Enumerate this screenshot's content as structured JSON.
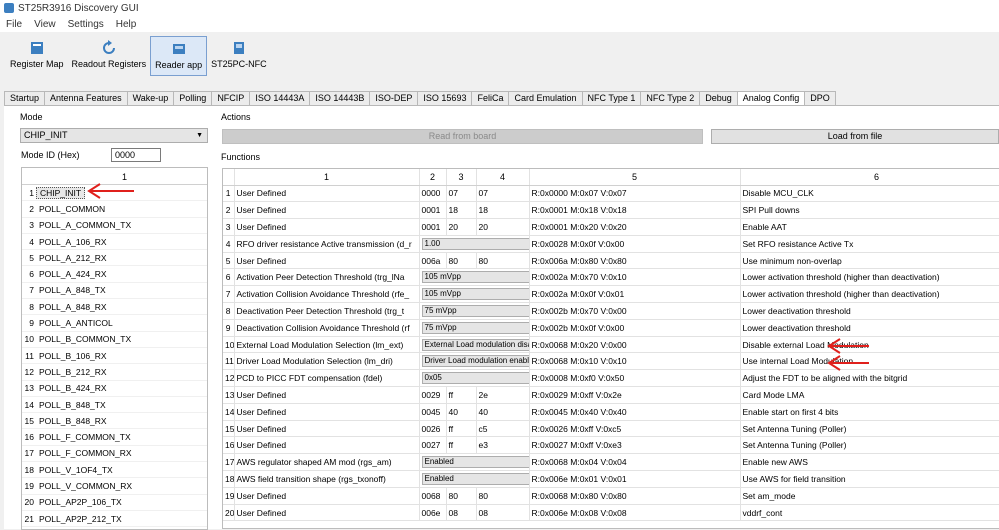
{
  "window": {
    "title": "ST25R3916 Discovery GUI"
  },
  "menu": [
    "File",
    "View",
    "Settings",
    "Help"
  ],
  "toolbar": [
    {
      "label": "Register Map",
      "icon": "register-map-icon",
      "active": false
    },
    {
      "label": "Readout Registers",
      "icon": "refresh-icon",
      "active": false
    },
    {
      "label": "Reader app",
      "icon": "reader-app-icon",
      "active": true
    },
    {
      "label": "ST25PC-NFC",
      "icon": "nfc-device-icon",
      "active": false
    }
  ],
  "tabs": [
    "Startup",
    "Antenna Features",
    "Wake-up",
    "Polling",
    "NFCIP",
    "ISO 14443A",
    "ISO 14443B",
    "ISO-DEP",
    "ISO 15693",
    "FeliCa",
    "Card Emulation",
    "NFC Type 1",
    "NFC Type 2",
    "Debug",
    "Analog Config",
    "DPO"
  ],
  "active_tab": "Analog Config",
  "mode": {
    "group_label": "Mode",
    "selected": "CHIP_INIT",
    "mode_id_label": "Mode ID (Hex)",
    "mode_id_value": "0000",
    "list_header": "1",
    "items": [
      "CHIP_INIT",
      "POLL_COMMON",
      "POLL_A_COMMON_TX",
      "POLL_A_106_RX",
      "POLL_A_212_RX",
      "POLL_A_424_RX",
      "POLL_A_848_TX",
      "POLL_A_848_RX",
      "POLL_A_ANTICOL",
      "POLL_B_COMMON_TX",
      "POLL_B_106_RX",
      "POLL_B_212_RX",
      "POLL_B_424_RX",
      "POLL_B_848_TX",
      "POLL_B_848_RX",
      "POLL_F_COMMON_TX",
      "POLL_F_COMMON_RX",
      "POLL_V_1OF4_TX",
      "POLL_V_COMMON_RX",
      "POLL_AP2P_106_TX",
      "POLL_AP2P_212_TX"
    ]
  },
  "actions": {
    "group_label": "Actions",
    "read_label": "Read from board",
    "load_label": "Load from file"
  },
  "functions": {
    "group_label": "Functions",
    "columns": [
      "1",
      "2",
      "3",
      "4",
      "5",
      "6"
    ],
    "rows": [
      {
        "name": "User Defined",
        "c2": "0000",
        "c3": "07",
        "c4": "07",
        "reg": "R:0x0000 M:0x07 V:0x07",
        "desc": "Disable MCU_CLK"
      },
      {
        "name": "User Defined",
        "c2": "0001",
        "c3": "18",
        "c4": "18",
        "reg": "R:0x0001 M:0x18 V:0x18",
        "desc": "SPI Pull downs"
      },
      {
        "name": "User Defined",
        "c2": "0001",
        "c3": "20",
        "c4": "20",
        "reg": "R:0x0001 M:0x20 V:0x20",
        "desc": "Enable AAT"
      },
      {
        "name": "RFO driver resistance Active transmission (d_r",
        "combo": "1.00",
        "reg": "R:0x0028 M:0x0f V:0x00",
        "desc": "Set RFO resistance Active Tx"
      },
      {
        "name": "User Defined",
        "c2": "006a",
        "c3": "80",
        "c4": "80",
        "reg": "R:0x006a M:0x80 V:0x80",
        "desc": "Use minimum non-overlap"
      },
      {
        "name": "Activation Peer Detection Threshold (trg_lNa",
        "combo": "105 mVpp",
        "reg": "R:0x002a M:0x70 V:0x10",
        "desc": "Lower activation threshold (higher than deactivation)"
      },
      {
        "name": "Activation Collision Avoidance Threshold (rfe_",
        "combo": "105 mVpp",
        "reg": "R:0x002a M:0x0f V:0x01",
        "desc": "Lower activation threshold (higher than deactivation)"
      },
      {
        "name": "Deactivation Peer Detection Threshold (trg_t",
        "combo": "75 mVpp",
        "reg": "R:0x002b M:0x70 V:0x00",
        "desc": "Lower deactivation threshold"
      },
      {
        "name": "Deactivation Collision Avoidance Threshold (rf",
        "combo": "75 mVpp",
        "reg": "R:0x002b M:0x0f V:0x00",
        "desc": "Lower deactivation threshold"
      },
      {
        "name": "External Load Modulation Selection (lm_ext)",
        "combo": "External Load modulation disablec",
        "reg": "R:0x0068 M:0x20 V:0x00",
        "desc": "Disable external Load Modulation"
      },
      {
        "name": "Driver Load Modulation Selection (lm_dri)",
        "combo": "Driver Load modulation enabled",
        "reg": "R:0x0068 M:0x10 V:0x10",
        "desc": "Use internal Load Modulation"
      },
      {
        "name": "PCD to PICC FDT compensation (fdel)",
        "combo": "0x05",
        "reg": "R:0x0008 M:0xf0 V:0x50",
        "desc": "Adjust the FDT to be aligned with the bitgrid"
      },
      {
        "name": "User Defined",
        "c2": "0029",
        "c3": "ff",
        "c4": "2e",
        "reg": "R:0x0029 M:0xff V:0x2e",
        "desc": "Card Mode LMA"
      },
      {
        "name": "User Defined",
        "c2": "0045",
        "c3": "40",
        "c4": "40",
        "reg": "R:0x0045 M:0x40 V:0x40",
        "desc": "Enable start on first 4 bits"
      },
      {
        "name": "User Defined",
        "c2": "0026",
        "c3": "ff",
        "c4": "c5",
        "reg": "R:0x0026 M:0xff V:0xc5",
        "desc": "Set Antenna Tuning (Poller)"
      },
      {
        "name": "User Defined",
        "c2": "0027",
        "c3": "ff",
        "c4": "e3",
        "reg": "R:0x0027 M:0xff V:0xe3",
        "desc": "Set Antenna Tuning (Poller)"
      },
      {
        "name": "AWS regulator shaped AM mod (rgs_am)",
        "combo": "Enabled",
        "reg": "R:0x0068 M:0x04 V:0x04",
        "desc": "Enable new AWS"
      },
      {
        "name": "AWS field transition shape (rgs_txonoff)",
        "combo": "Enabled",
        "reg": "R:0x006e M:0x01 V:0x01",
        "desc": "Use AWS for field transition"
      },
      {
        "name": "User Defined",
        "c2": "0068",
        "c3": "80",
        "c4": "80",
        "reg": "R:0x0068 M:0x80 V:0x80",
        "desc": "Set am_mode"
      },
      {
        "name": "User Defined",
        "c2": "006e",
        "c3": "08",
        "c4": "08",
        "reg": "R:0x006e M:0x08 V:0x08",
        "desc": "vddrf_cont"
      }
    ]
  },
  "colors": {
    "annotation_arrow": "#e0201c",
    "accent": "#3c7fc0"
  }
}
